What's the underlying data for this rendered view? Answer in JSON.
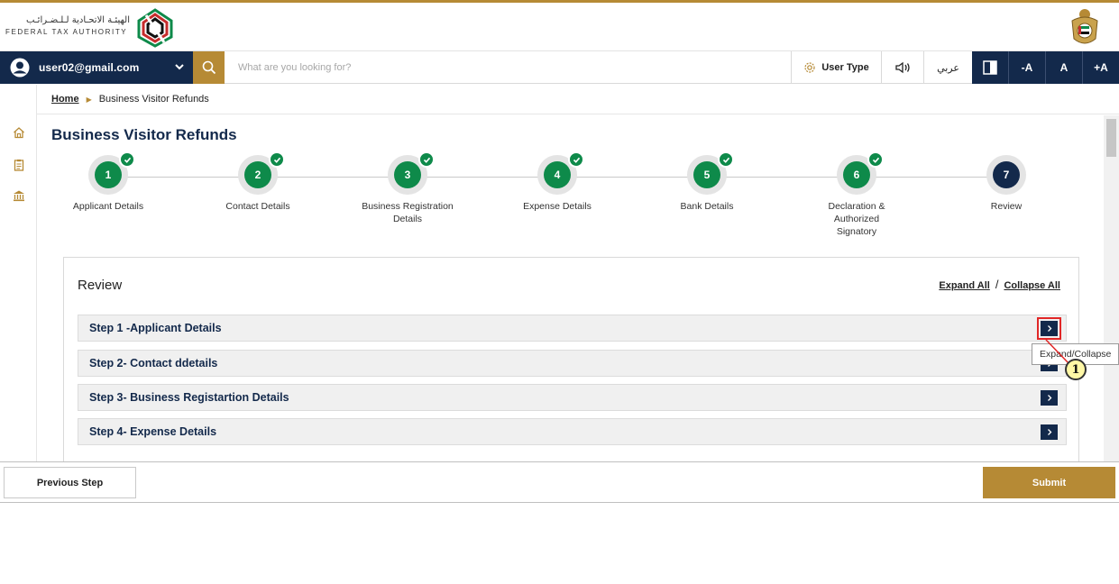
{
  "header": {
    "logo_arabic": "الهيئـة الاتحـادية لـلـضـرائـب",
    "logo_english": "FEDERAL TAX AUTHORITY"
  },
  "toolbar": {
    "user_email": "user02@gmail.com",
    "search_placeholder": "What are you looking for?",
    "user_type_label": "User Type",
    "arabic_label": "عربي",
    "font_decrease_label": "-A",
    "font_normal_label": "A",
    "font_increase_label": "+A"
  },
  "breadcrumb": {
    "home": "Home",
    "current": "Business Visitor Refunds"
  },
  "page": {
    "title": "Business Visitor Refunds"
  },
  "stepper": {
    "steps": [
      {
        "number": "1",
        "label": "Applicant Details",
        "completed": true
      },
      {
        "number": "2",
        "label": "Contact Details",
        "completed": true
      },
      {
        "number": "3",
        "label": "Business Registration Details",
        "completed": true
      },
      {
        "number": "4",
        "label": "Expense Details",
        "completed": true
      },
      {
        "number": "5",
        "label": "Bank Details",
        "completed": true
      },
      {
        "number": "6",
        "label": "Declaration & Authorized Signatory",
        "completed": true
      },
      {
        "number": "7",
        "label": "Review",
        "completed": false
      }
    ]
  },
  "review": {
    "title": "Review",
    "expand_all": "Expand All",
    "separator": "/",
    "collapse_all": "Collapse All",
    "sections": [
      {
        "label": "Step 1 -Applicant Details"
      },
      {
        "label": "Step 2- Contact ddetails"
      },
      {
        "label": "Step 3- Business Registartion Details"
      },
      {
        "label": "Step 4- Expense Details"
      }
    ]
  },
  "footer": {
    "previous_label": "Previous Step",
    "submit_label": "Submit"
  },
  "annotation": {
    "tooltip": "Expand/Collapse",
    "callout_number": "1"
  },
  "colors": {
    "navy": "#13294b",
    "gold": "#b68a35",
    "green": "#0e8a4a",
    "highlight_red": "#e12727"
  }
}
